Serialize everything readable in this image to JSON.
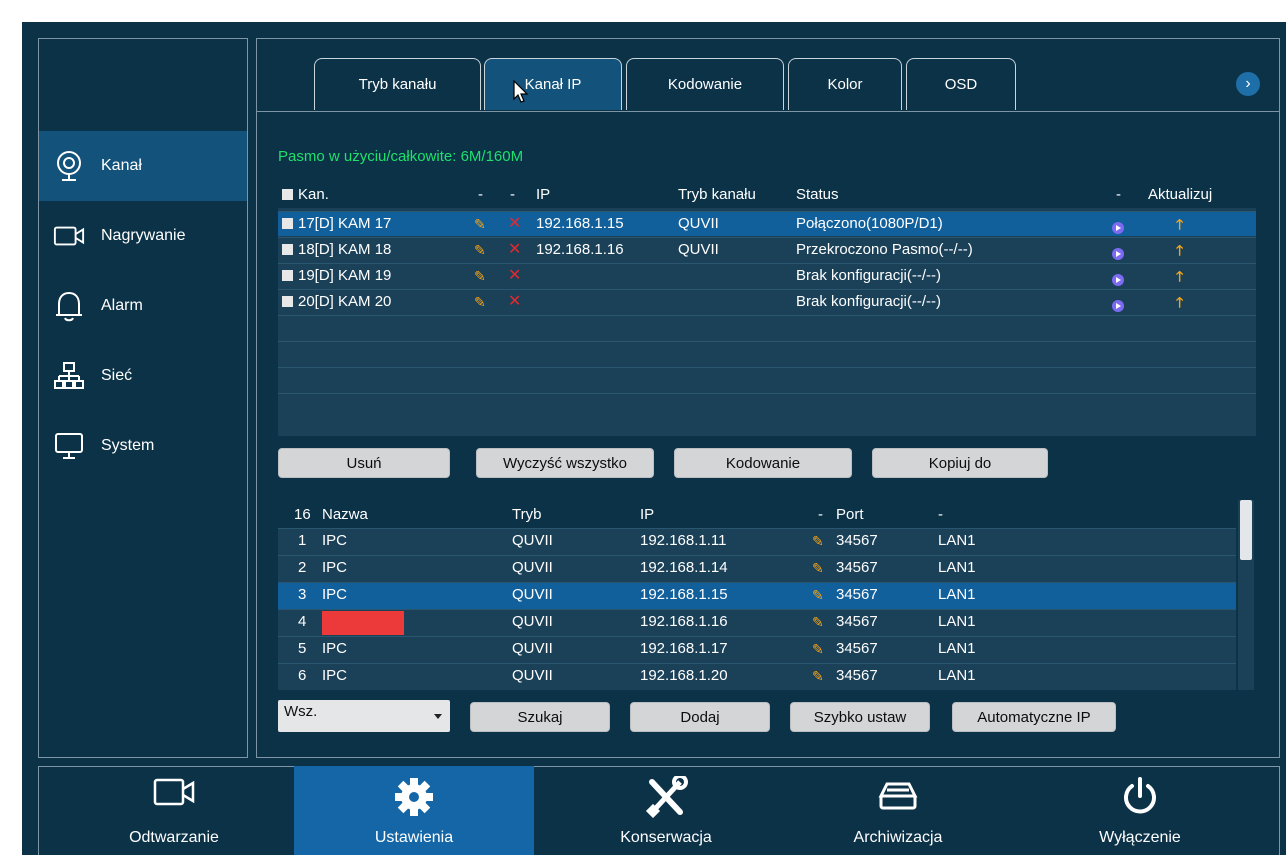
{
  "sidebar": {
    "items": [
      {
        "label": "Kanał",
        "icon": "camera-lens-icon"
      },
      {
        "label": "Nagrywanie",
        "icon": "video-camera-icon"
      },
      {
        "label": "Alarm",
        "icon": "bell-icon"
      },
      {
        "label": "Sieć",
        "icon": "network-icon"
      },
      {
        "label": "System",
        "icon": "monitor-icon"
      }
    ]
  },
  "tabs": [
    {
      "label": "Tryb kanału"
    },
    {
      "label": "Kanał IP"
    },
    {
      "label": "Kodowanie"
    },
    {
      "label": "Kolor"
    },
    {
      "label": "OSD"
    }
  ],
  "tab_next_label": "›",
  "bandwidth": "Pasmo w użyciu/całkowite: 6M/160M",
  "channel_table": {
    "headers": {
      "kan": "Kan.",
      "dash1": "-",
      "dash2": "-",
      "ip": "IP",
      "mode": "Tryb kanału",
      "status": "Status",
      "dash3": "-",
      "update": "Aktualizuj"
    },
    "rows": [
      {
        "name": "17[D] KAM 17",
        "ip": "192.168.1.15",
        "mode": "QUVII",
        "status": "Połączono(1080P/D1)"
      },
      {
        "name": "18[D] KAM 18",
        "ip": "192.168.1.16",
        "mode": "QUVII",
        "status": "Przekroczono Pasmo(--/--)"
      },
      {
        "name": "19[D] KAM 19",
        "ip": "",
        "mode": "",
        "status": "Brak konfiguracji(--/--)"
      },
      {
        "name": "20[D] KAM 20",
        "ip": "",
        "mode": "",
        "status": "Brak konfiguracji(--/--)"
      }
    ],
    "selected_row": 0
  },
  "buttons_top": {
    "delete": "Usuń",
    "clear_all": "Wyczyść wszystko",
    "encoding": "Kodowanie",
    "copy_to": "Kopiuj do"
  },
  "device_table": {
    "headers": {
      "count": "16",
      "name": "Nazwa",
      "mode": "Tryb",
      "ip": "IP",
      "dash": "-",
      "port": "Port",
      "dash2": "-"
    },
    "rows": [
      {
        "idx": "1",
        "name": "IPC",
        "mode": "QUVII",
        "ip": "192.168.1.11",
        "port": "34567",
        "net": "LAN1"
      },
      {
        "idx": "2",
        "name": "IPC",
        "mode": "QUVII",
        "ip": "192.168.1.14",
        "port": "34567",
        "net": "LAN1"
      },
      {
        "idx": "3",
        "name": "IPC",
        "mode": "QUVII",
        "ip": "192.168.1.15",
        "port": "34567",
        "net": "LAN1"
      },
      {
        "idx": "4",
        "name": "",
        "mode": "QUVII",
        "ip": "192.168.1.16",
        "port": "34567",
        "net": "LAN1"
      },
      {
        "idx": "5",
        "name": "IPC",
        "mode": "QUVII",
        "ip": "192.168.1.17",
        "port": "34567",
        "net": "LAN1"
      },
      {
        "idx": "6",
        "name": "IPC",
        "mode": "QUVII",
        "ip": "192.168.1.20",
        "port": "34567",
        "net": "LAN1"
      }
    ],
    "selected_row": 2
  },
  "filter_dropdown": {
    "value": "Wsz."
  },
  "buttons_bottom": {
    "search": "Szukaj",
    "add": "Dodaj",
    "quick_setup": "Szybko ustaw",
    "auto_ip": "Automatyczne IP"
  },
  "bottom_bar": {
    "items": [
      {
        "label": "Odtwarzanie",
        "icon": "video-camera-icon"
      },
      {
        "label": "Ustawienia",
        "icon": "gear-icon"
      },
      {
        "label": "Konserwacja",
        "icon": "wrench-screwdriver-icon"
      },
      {
        "label": "Archiwizacja",
        "icon": "drive-icon"
      },
      {
        "label": "Wyłączenie",
        "icon": "power-icon"
      }
    ],
    "active": 1
  },
  "colors": {
    "background": "#0c3248",
    "selected": "#12609b",
    "bandwidth_text": "#1fe06b",
    "accent": "#1466a7"
  }
}
